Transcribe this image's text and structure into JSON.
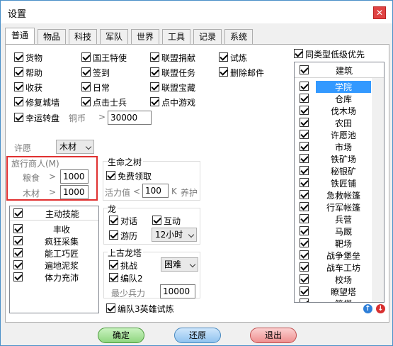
{
  "window": {
    "title": "设置",
    "close_glyph": "✕"
  },
  "tabs": [
    "普通",
    "物品",
    "科技",
    "军队",
    "世界",
    "工具",
    "记录",
    "系统"
  ],
  "checks_col1": [
    {
      "label": "货物",
      "checked": true
    },
    {
      "label": "帮助",
      "checked": true
    },
    {
      "label": "收获",
      "checked": true
    },
    {
      "label": "修复城墙",
      "checked": true
    }
  ],
  "checks_col2": [
    {
      "label": "国王特使",
      "checked": true
    },
    {
      "label": "签到",
      "checked": true
    },
    {
      "label": "日常",
      "checked": true
    },
    {
      "label": "点击士兵",
      "checked": true
    }
  ],
  "checks_col3": [
    {
      "label": "联盟捐献",
      "checked": true
    },
    {
      "label": "联盟任务",
      "checked": true
    },
    {
      "label": "联盟宝藏",
      "checked": true
    },
    {
      "label": "点中游戏",
      "checked": true
    }
  ],
  "checks_col4": [
    {
      "label": "试炼",
      "checked": true
    },
    {
      "label": "删除邮件",
      "checked": true
    }
  ],
  "lucky_wheel": {
    "label": "幸运转盘",
    "checked": true,
    "cost_label": "铜币",
    "op": ">",
    "value": "30000"
  },
  "wish": {
    "label": "许愿",
    "value": "木材"
  },
  "traveling_merchant": {
    "title": "旅行商人(M)",
    "food_label": "粮食",
    "food_op": ">",
    "food_value": "1000",
    "wood_label": "木材",
    "wood_op": ">",
    "wood_value": "1000"
  },
  "tree_of_life": {
    "title": "生命之树",
    "free_claim_label": "免费领取",
    "free_claim_checked": true,
    "vitality_label": "活力值",
    "vitality_op": "<",
    "vitality_value": "100",
    "unit": "K",
    "maintain_label": "养护"
  },
  "skills": {
    "header": "主动技能",
    "items": [
      "丰收",
      "疯狂采集",
      "能工巧匠",
      "遍地泥浆",
      "体力充沛"
    ]
  },
  "dragon": {
    "title": "龙",
    "dialog_label": "对话",
    "interact_label": "互动",
    "travel_label": "游历",
    "travel_value": "12小时"
  },
  "ancient_tower": {
    "title": "上古龙塔",
    "challenge_label": "挑战",
    "difficulty_value": "困难",
    "team2_label": "编队2",
    "min_troops_label": "最少兵力",
    "min_troops_value": "10000"
  },
  "team3_hero": {
    "label": "编队3英雄试炼",
    "checked": true
  },
  "same_type_low_priority": {
    "label": "同类型低级优先",
    "checked": true
  },
  "buildings": {
    "header": "建筑",
    "items": [
      "学院",
      "仓库",
      "伐木场",
      "农田",
      "许愿池",
      "市场",
      "铁矿场",
      "秘银矿",
      "铁匠铺",
      "急救帐篷",
      "行军帐篷",
      "兵营",
      "马厩",
      "靶场",
      "战争堡垒",
      "战车工坊",
      "校场",
      "瞭望塔",
      "箭塔"
    ],
    "selected_index": 0
  },
  "buttons": {
    "ok": "确定",
    "restore": "还原",
    "exit": "退出",
    "up_glyph": "↑",
    "down_glyph": "↓"
  },
  "colors": {
    "selection": "#3399ff",
    "highlight_frame": "#e03030",
    "ok": "#8fd67f",
    "restore": "#8fc3ef",
    "exit": "#ef8f8f"
  }
}
